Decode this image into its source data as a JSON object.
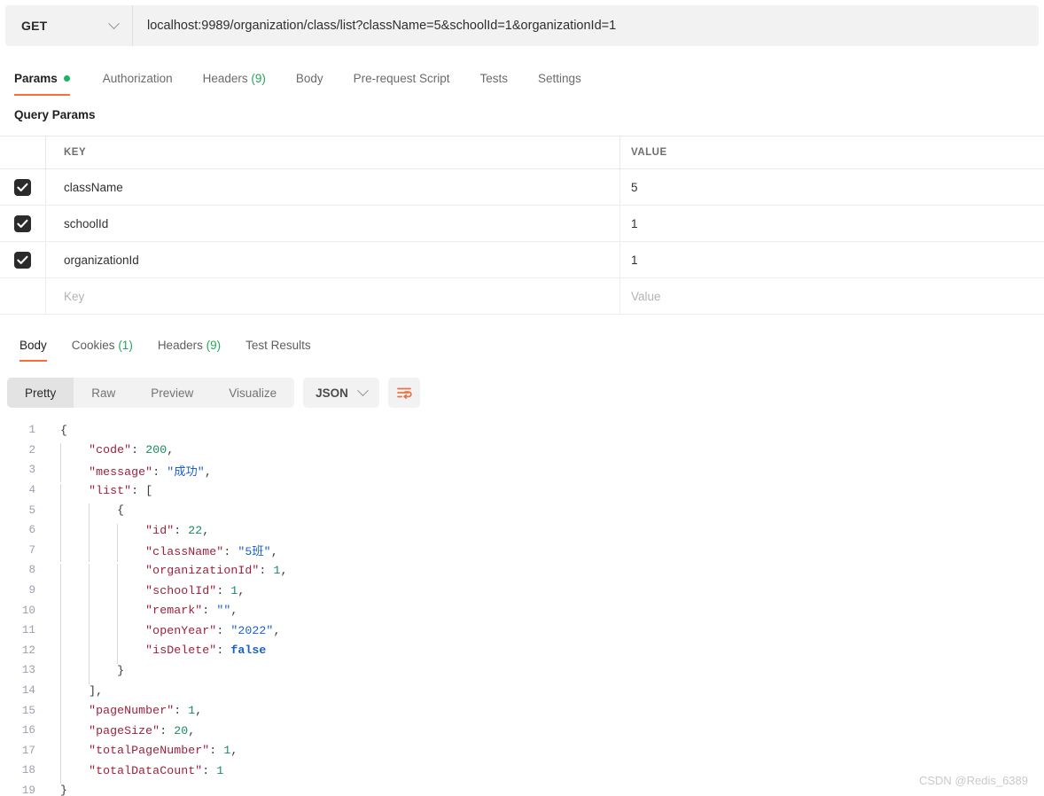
{
  "request": {
    "method": "GET",
    "url": "localhost:9989/organization/class/list?className=5&schoolId=1&organizationId=1",
    "tabs": [
      {
        "label": "Params",
        "active": true,
        "dot": true
      },
      {
        "label": "Authorization",
        "active": false
      },
      {
        "label": "Headers",
        "count": "(9)",
        "active": false
      },
      {
        "label": "Body",
        "active": false
      },
      {
        "label": "Pre-request Script",
        "active": false
      },
      {
        "label": "Tests",
        "active": false
      },
      {
        "label": "Settings",
        "active": false
      }
    ],
    "section_title": "Query Params",
    "table": {
      "headers": {
        "key": "KEY",
        "value": "VALUE"
      },
      "rows": [
        {
          "checked": true,
          "key": "className",
          "value": "5"
        },
        {
          "checked": true,
          "key": "schoolId",
          "value": "1"
        },
        {
          "checked": true,
          "key": "organizationId",
          "value": "1"
        }
      ],
      "placeholder_row": {
        "key": "Key",
        "value": "Value"
      }
    }
  },
  "response": {
    "tabs": [
      {
        "label": "Body",
        "active": true
      },
      {
        "label": "Cookies",
        "count": "(1)",
        "active": false
      },
      {
        "label": "Headers",
        "count": "(9)",
        "active": false
      },
      {
        "label": "Test Results",
        "active": false
      }
    ],
    "view_modes": [
      {
        "label": "Pretty",
        "active": true
      },
      {
        "label": "Raw",
        "active": false
      },
      {
        "label": "Preview",
        "active": false
      },
      {
        "label": "Visualize",
        "active": false
      }
    ],
    "format": "JSON",
    "body_raw": {
      "code": 200,
      "message": "成功",
      "list": [
        {
          "id": 22,
          "className": "5班",
          "organizationId": 1,
          "schoolId": 1,
          "remark": "",
          "openYear": "2022",
          "isDelete": false
        }
      ],
      "pageNumber": 1,
      "pageSize": 20,
      "totalPageNumber": 1,
      "totalDataCount": 1
    },
    "body_lines": [
      {
        "no": "1",
        "indent": 0,
        "tokens": [
          {
            "t": "{",
            "c": "p"
          }
        ]
      },
      {
        "no": "2",
        "indent": 1,
        "tokens": [
          {
            "t": "\"code\"",
            "c": "k"
          },
          {
            "t": ": ",
            "c": "p"
          },
          {
            "t": "200",
            "c": "n"
          },
          {
            "t": ",",
            "c": "p"
          }
        ]
      },
      {
        "no": "3",
        "indent": 1,
        "tokens": [
          {
            "t": "\"message\"",
            "c": "k"
          },
          {
            "t": ": ",
            "c": "p"
          },
          {
            "t": "\"成功\"",
            "c": "s"
          },
          {
            "t": ",",
            "c": "p"
          }
        ]
      },
      {
        "no": "4",
        "indent": 1,
        "tokens": [
          {
            "t": "\"list\"",
            "c": "k"
          },
          {
            "t": ": ",
            "c": "p"
          },
          {
            "t": "[",
            "c": "p"
          }
        ]
      },
      {
        "no": "5",
        "indent": 2,
        "tokens": [
          {
            "t": "{",
            "c": "p"
          }
        ]
      },
      {
        "no": "6",
        "indent": 3,
        "tokens": [
          {
            "t": "\"id\"",
            "c": "k"
          },
          {
            "t": ": ",
            "c": "p"
          },
          {
            "t": "22",
            "c": "n"
          },
          {
            "t": ",",
            "c": "p"
          }
        ]
      },
      {
        "no": "7",
        "indent": 3,
        "tokens": [
          {
            "t": "\"className\"",
            "c": "k"
          },
          {
            "t": ": ",
            "c": "p"
          },
          {
            "t": "\"5班\"",
            "c": "s"
          },
          {
            "t": ",",
            "c": "p"
          }
        ]
      },
      {
        "no": "8",
        "indent": 3,
        "tokens": [
          {
            "t": "\"organizationId\"",
            "c": "k"
          },
          {
            "t": ": ",
            "c": "p"
          },
          {
            "t": "1",
            "c": "n"
          },
          {
            "t": ",",
            "c": "p"
          }
        ]
      },
      {
        "no": "9",
        "indent": 3,
        "tokens": [
          {
            "t": "\"schoolId\"",
            "c": "k"
          },
          {
            "t": ": ",
            "c": "p"
          },
          {
            "t": "1",
            "c": "n"
          },
          {
            "t": ",",
            "c": "p"
          }
        ]
      },
      {
        "no": "10",
        "indent": 3,
        "tokens": [
          {
            "t": "\"remark\"",
            "c": "k"
          },
          {
            "t": ": ",
            "c": "p"
          },
          {
            "t": "\"\"",
            "c": "s"
          },
          {
            "t": ",",
            "c": "p"
          }
        ]
      },
      {
        "no": "11",
        "indent": 3,
        "tokens": [
          {
            "t": "\"openYear\"",
            "c": "k"
          },
          {
            "t": ": ",
            "c": "p"
          },
          {
            "t": "\"2022\"",
            "c": "s"
          },
          {
            "t": ",",
            "c": "p"
          }
        ]
      },
      {
        "no": "12",
        "indent": 3,
        "tokens": [
          {
            "t": "\"isDelete\"",
            "c": "k"
          },
          {
            "t": ": ",
            "c": "p"
          },
          {
            "t": "false",
            "c": "b"
          }
        ]
      },
      {
        "no": "13",
        "indent": 2,
        "tokens": [
          {
            "t": "}",
            "c": "p"
          }
        ]
      },
      {
        "no": "14",
        "indent": 1,
        "tokens": [
          {
            "t": "],",
            "c": "p"
          }
        ]
      },
      {
        "no": "15",
        "indent": 1,
        "tokens": [
          {
            "t": "\"pageNumber\"",
            "c": "k"
          },
          {
            "t": ": ",
            "c": "p"
          },
          {
            "t": "1",
            "c": "n"
          },
          {
            "t": ",",
            "c": "p"
          }
        ]
      },
      {
        "no": "16",
        "indent": 1,
        "tokens": [
          {
            "t": "\"pageSize\"",
            "c": "k"
          },
          {
            "t": ": ",
            "c": "p"
          },
          {
            "t": "20",
            "c": "n"
          },
          {
            "t": ",",
            "c": "p"
          }
        ]
      },
      {
        "no": "17",
        "indent": 1,
        "tokens": [
          {
            "t": "\"totalPageNumber\"",
            "c": "k"
          },
          {
            "t": ": ",
            "c": "p"
          },
          {
            "t": "1",
            "c": "n"
          },
          {
            "t": ",",
            "c": "p"
          }
        ]
      },
      {
        "no": "18",
        "indent": 1,
        "tokens": [
          {
            "t": "\"totalDataCount\"",
            "c": "k"
          },
          {
            "t": ": ",
            "c": "p"
          },
          {
            "t": "1",
            "c": "n"
          }
        ]
      },
      {
        "no": "19",
        "indent": 0,
        "tokens": [
          {
            "t": "}",
            "c": "p"
          }
        ]
      }
    ]
  },
  "watermark": "CSDN @Redis_6389",
  "colors": {
    "accent": "#ff6c37",
    "dot_green": "#18b566",
    "count_green": "#26a65b",
    "json_key": "#a11f3a",
    "json_string": "#1a5fd0",
    "json_number": "#178c5a",
    "json_bool": "#1a5fd0"
  }
}
